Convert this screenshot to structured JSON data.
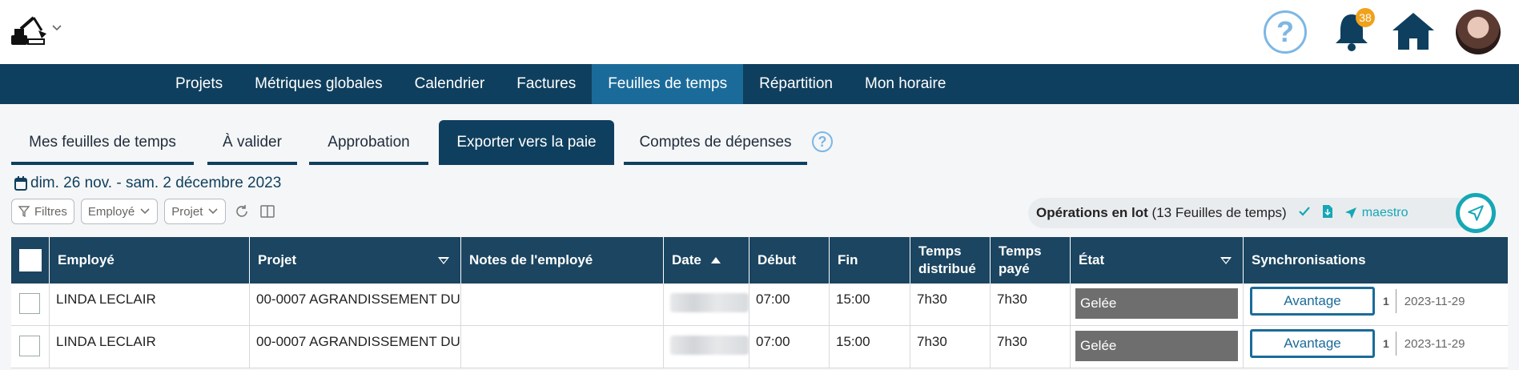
{
  "header": {
    "help_label": "?",
    "notification_count": "38"
  },
  "main_nav": {
    "items": [
      {
        "label": "Projets"
      },
      {
        "label": "Métriques globales"
      },
      {
        "label": "Calendrier"
      },
      {
        "label": "Factures"
      },
      {
        "label": "Feuilles de temps",
        "active": true
      },
      {
        "label": "Répartition"
      },
      {
        "label": "Mon horaire"
      }
    ]
  },
  "sub_tabs": {
    "items": [
      {
        "label": "Mes feuilles de temps"
      },
      {
        "label": "À valider"
      },
      {
        "label": "Approbation"
      },
      {
        "label": "Exporter vers la paie",
        "active": true
      },
      {
        "label": "Comptes de dépenses"
      }
    ],
    "help_label": "?"
  },
  "date_range": "dim. 26 nov. - sam. 2 décembre 2023",
  "filters": {
    "filtres": "Filtres",
    "employe": "Employé",
    "projet": "Projet"
  },
  "batch": {
    "label_bold": "Opérations en lot",
    "label_rest": "(13 Feuilles de temps)",
    "maestro": "maestro"
  },
  "table": {
    "headers": {
      "employe": "Employé",
      "projet": "Projet",
      "notes": "Notes de l'employé",
      "date": "Date",
      "debut": "Début",
      "fin": "Fin",
      "temps_distribue_1": "Temps",
      "temps_distribue_2": "distribué",
      "temps_paye_1": "Temps",
      "temps_paye_2": "payé",
      "etat": "État",
      "sync": "Synchronisations"
    },
    "rows": [
      {
        "employe": "LINDA LECLAIR",
        "projet": "00-0007 AGRANDISSEMENT DU",
        "notes": "",
        "debut": "07:00",
        "fin": "15:00",
        "temps_distribue": "7h30",
        "temps_paye": "7h30",
        "etat": "Gelée",
        "sync_button": "Avantage",
        "sync_count": "1",
        "sync_date": "2023-11-29"
      },
      {
        "employe": "LINDA LECLAIR",
        "projet": "00-0007 AGRANDISSEMENT DU",
        "notes": "",
        "debut": "07:00",
        "fin": "15:00",
        "temps_distribue": "7h30",
        "temps_paye": "7h30",
        "etat": "Gelée",
        "sync_button": "Avantage",
        "sync_count": "1",
        "sync_date": "2023-11-29"
      }
    ]
  },
  "colors": {
    "nav_bg": "#0f3f5e",
    "nav_active": "#1b6b9a",
    "table_header": "#1b4560",
    "accent_teal": "#16a7b5",
    "badge": "#f0a21c",
    "state_bg": "#6e6e6e"
  }
}
